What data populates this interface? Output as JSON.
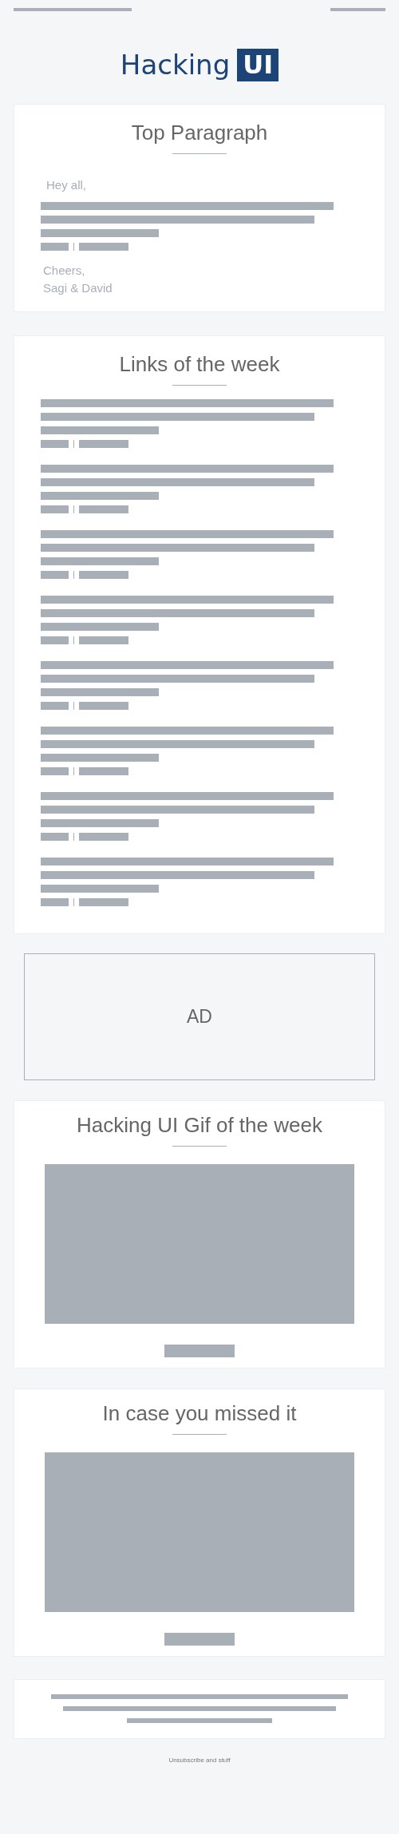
{
  "header": {
    "logo_text": "Hacking",
    "logo_badge": "UI"
  },
  "top_paragraph": {
    "title": "Top Paragraph",
    "greeting": "Hey all,",
    "signoff": [
      "Cheers,",
      "Sagi & David"
    ]
  },
  "links": {
    "title": "Links of the week",
    "items": [
      {
        "kind": "placeholder"
      },
      {
        "kind": "placeholder"
      },
      {
        "kind": "placeholder"
      },
      {
        "kind": "placeholder"
      },
      {
        "kind": "placeholder"
      },
      {
        "kind": "placeholder"
      },
      {
        "kind": "placeholder"
      },
      {
        "kind": "placeholder"
      }
    ]
  },
  "ad": {
    "label": "AD"
  },
  "gif_of_week": {
    "title": "Hacking UI Gif of the week"
  },
  "missed": {
    "title": "In case you missed it"
  },
  "footer": {
    "note": "Unsubscribe and stuff"
  }
}
